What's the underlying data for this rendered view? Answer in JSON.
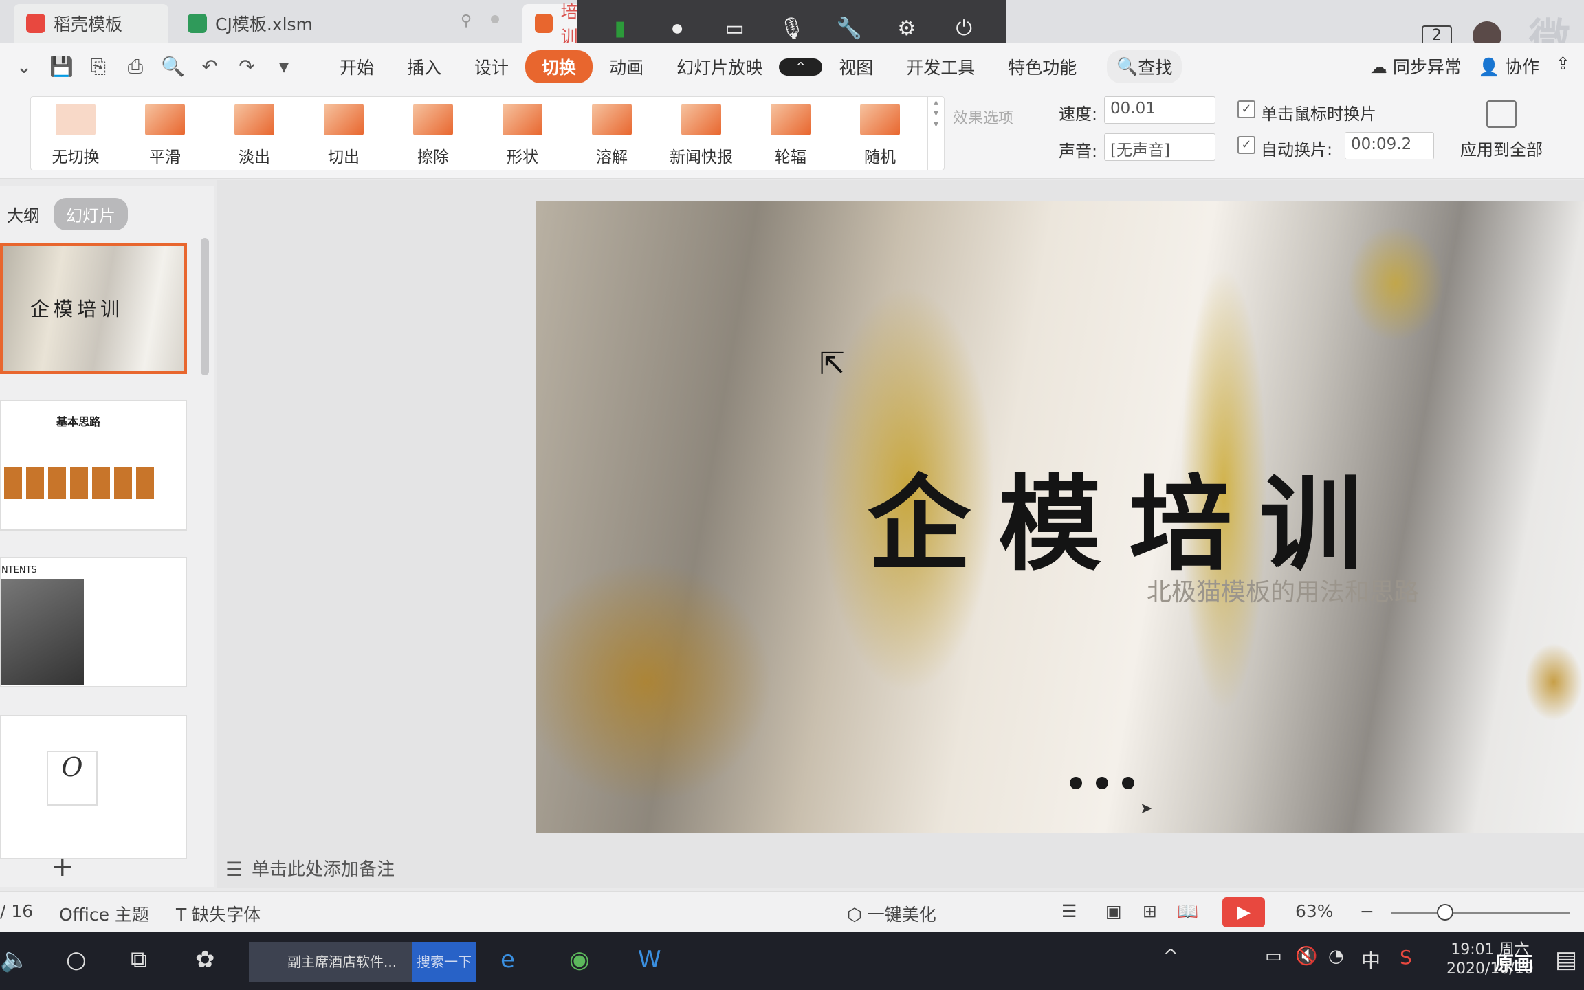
{
  "tabs": [
    {
      "label": "稻壳模板"
    },
    {
      "label": "CJ模板.xlsm"
    },
    {
      "label": "培训.pptx"
    }
  ],
  "header": {
    "window_count": "2"
  },
  "menu": {
    "items": [
      "开始",
      "插入",
      "设计",
      "切换",
      "动画",
      "幻灯片放映",
      "",
      "视图",
      "开发工具",
      "特色功能"
    ],
    "active": "切换",
    "search": "查找",
    "sync": "同步异常",
    "collab": "协作"
  },
  "transitions": [
    "无切换",
    "平滑",
    "淡出",
    "切出",
    "擦除",
    "形状",
    "溶解",
    "新闻快报",
    "轮辐",
    "随机"
  ],
  "ribbon": {
    "effect_options": "效果选项",
    "speed_label": "速度:",
    "speed_value": "00.01",
    "sound_label": "声音:",
    "sound_value": "[无声音]",
    "on_click_label": "单击鼠标时换片",
    "auto_label": "自动换片:",
    "auto_value": "00:09.2",
    "apply_all": "应用到全部"
  },
  "panel": {
    "outline": "大纲",
    "slides": "幻灯片"
  },
  "thumbs": {
    "t1_title": "企模培训",
    "t2_title": "基本思路",
    "t3_title": "NTENTS",
    "t4_glyph": "O"
  },
  "slide": {
    "title": "企模培训",
    "subtitle": "北极猫模板的用法和思路"
  },
  "notes": "单击此处添加备注",
  "status": {
    "page": "/ 16",
    "theme": "Office 主题",
    "missing_font": "缺失字体",
    "beautify": "一键美化",
    "zoom": "63%"
  },
  "taskbar": {
    "app": "副主席酒店软件...",
    "search": "搜索一下",
    "time": "19:01 周六",
    "date": "2020/10/10",
    "mode": "原画"
  }
}
